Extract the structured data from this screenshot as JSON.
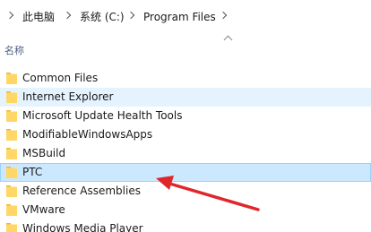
{
  "breadcrumb": {
    "items": [
      {
        "label": "此电脑"
      },
      {
        "label": "系统 (C:)"
      },
      {
        "label": "Program Files"
      }
    ]
  },
  "columns": {
    "name_header": "名称"
  },
  "files": [
    {
      "name": "Common Files",
      "state": "normal"
    },
    {
      "name": "Internet Explorer",
      "state": "hover"
    },
    {
      "name": "Microsoft Update Health Tools",
      "state": "normal"
    },
    {
      "name": "ModifiableWindowsApps",
      "state": "normal"
    },
    {
      "name": "MSBuild",
      "state": "normal"
    },
    {
      "name": "PTC",
      "state": "selected"
    },
    {
      "name": "Reference Assemblies",
      "state": "normal"
    },
    {
      "name": "VMware",
      "state": "normal"
    },
    {
      "name": "Windows Media Player",
      "state": "normal"
    }
  ],
  "icons": {
    "folder": "folder-icon",
    "breadcrumb_separator": "chevron-right-icon",
    "sort": "chevron-up-icon"
  },
  "colors": {
    "folder_fill": "#ffd767",
    "folder_tab": "#e8b93c",
    "hover_bg": "#e5f3ff",
    "selected_bg": "#cce8ff",
    "selected_border": "#99d1ff",
    "annotation_arrow": "#e0262b",
    "header_text": "#4d6082"
  }
}
